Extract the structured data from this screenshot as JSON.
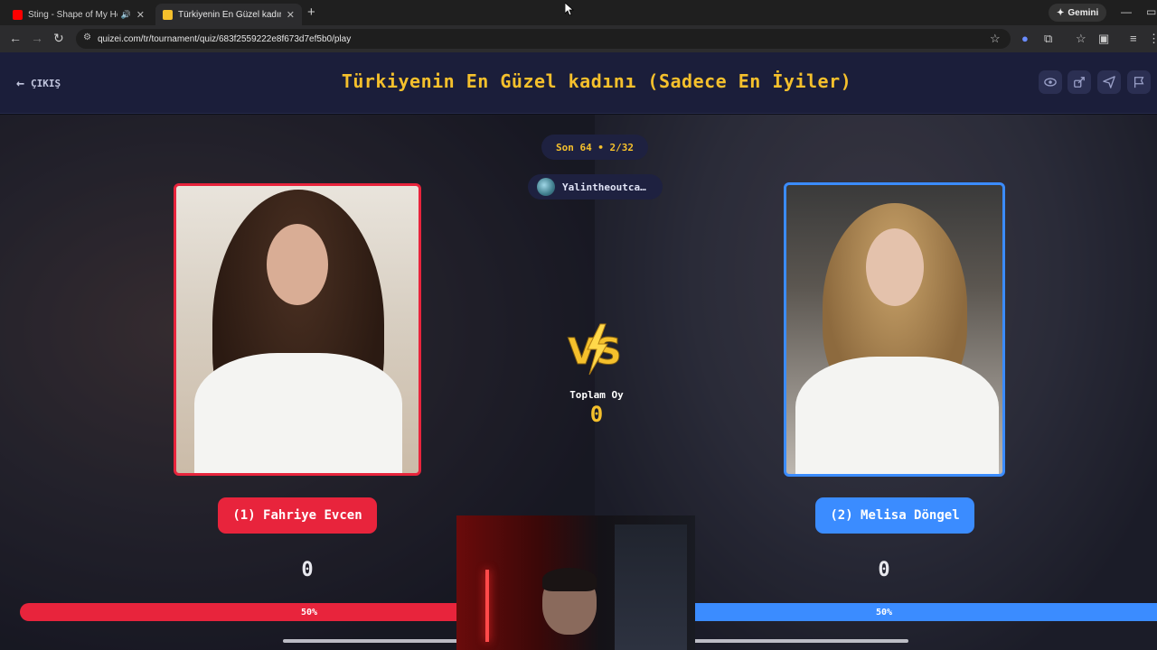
{
  "browser": {
    "tabs": [
      {
        "title": "Sting - Shape of My Heart (",
        "favicon_color": "#ff0000"
      },
      {
        "title": "Türkiyenin En Güzel kadını (Sad",
        "favicon_color": "#f5c02c"
      }
    ],
    "gemini_label": "Gemini",
    "url": "quizei.com/tr/tournament/quiz/683f2559222e8f673d7ef5b0/play"
  },
  "header": {
    "exit_label": "ÇIKIŞ",
    "title": "Türkiyenin En Güzel kadını (Sadece En İyiler)"
  },
  "match": {
    "round_label": "Son 64 • 2/32",
    "creator_name": "Yalintheoutca…",
    "total_votes_label": "Toplam Oy",
    "total_votes": "0",
    "left": {
      "name": "(1) Fahriye Evcen",
      "votes": "0",
      "percent_label": "50%",
      "percent": 50,
      "color": "#e8243c"
    },
    "right": {
      "name": "(2) Melisa Döngel",
      "votes": "0",
      "percent_label": "50%",
      "percent": 50,
      "color": "#3b8cff"
    }
  },
  "colors": {
    "accent": "#f5c02c",
    "header_bg": "#1b1e3a"
  }
}
